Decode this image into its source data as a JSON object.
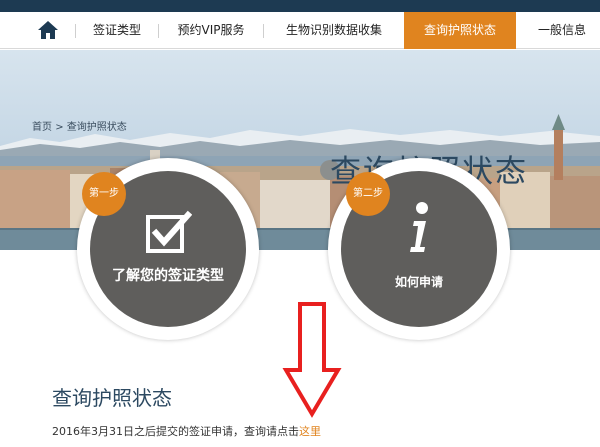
{
  "nav": {
    "items": [
      {
        "label": "签证类型",
        "active": false
      },
      {
        "label": "预约VIP服务",
        "active": false
      },
      {
        "label": "生物识别数据收集",
        "active": false
      },
      {
        "label": "查询护照状态",
        "active": true
      },
      {
        "label": "一般信息",
        "active": false
      }
    ],
    "home_icon": "home-icon"
  },
  "hero": {
    "breadcrumb_home": "首页",
    "breadcrumb_sep": ">",
    "breadcrumb_current": "查询护照状态",
    "title": "查询护照状态"
  },
  "steps": [
    {
      "badge": "第一步",
      "label": "了解您的签证类型",
      "icon": "checkbox-icon"
    },
    {
      "badge": "第二步",
      "label": "如何申请",
      "icon": "info-icon"
    }
  ],
  "section": {
    "title": "查询护照状态",
    "text_prefix": "2016年3月31日之后提交的签证申请，查询请点击",
    "link_label": "这里"
  },
  "colors": {
    "accent": "#e0841f",
    "top_bar": "#1d3a52",
    "title": "#2c4961",
    "circle": "#5f5e5c",
    "arrow": "#e8201f"
  }
}
